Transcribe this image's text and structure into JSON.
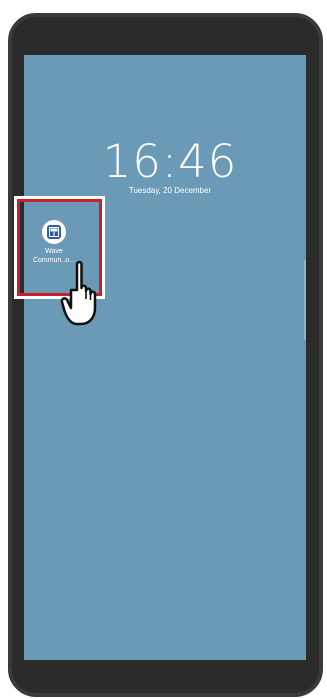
{
  "lockscreen": {
    "time": "16:46",
    "date": "Tuesday, 20 December"
  },
  "app": {
    "label_line1": "Wave",
    "label_line2": "Commun..o...",
    "icon": "wave-app-icon"
  },
  "annotation": {
    "highlight_color": "#c8202d",
    "cursor_icon": "hand-pointer-icon"
  },
  "colors": {
    "wallpaper": "#6a9ab5",
    "frame": "#2b2b2b"
  }
}
